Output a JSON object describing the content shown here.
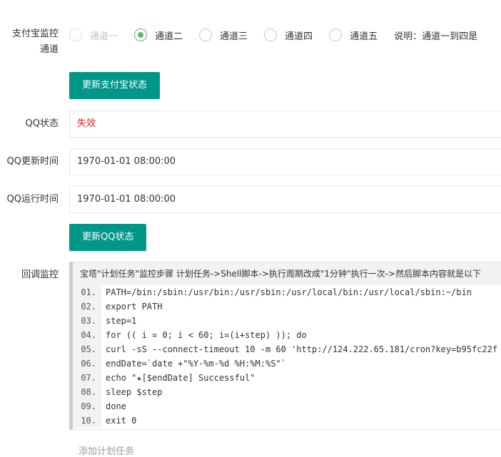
{
  "alipay": {
    "label_line1": "支付宝监控",
    "label_line2": "通道",
    "channels": [
      "通道一",
      "通道二",
      "通道三",
      "通道四",
      "通道五"
    ],
    "selected": "通道二",
    "disabled": "通道一",
    "note": "说明：通道一到四是",
    "update_button": "更新支付宝状态"
  },
  "qq": {
    "status_label": "QQ状态",
    "status_value": "失效",
    "update_time_label": "QQ更新时间",
    "update_time_value": "1970-01-01 08:00:00",
    "run_time_label": "QQ运行时间",
    "run_time_value": "1970-01-01 08:00:00",
    "update_button": "更新QQ状态"
  },
  "callback": {
    "label": "回调监控",
    "header": "宝塔\"计划任务\"监控步骤 计划任务->Shell脚本->执行周期改成\"1分钟\"执行一次->然后脚本内容就是以下",
    "lines": [
      {
        "num": "01.",
        "code": "PATH=/bin:/sbin:/usr/bin:/usr/sbin:/usr/local/bin:/usr/local/sbin:~/bin"
      },
      {
        "num": "02.",
        "code": "export PATH"
      },
      {
        "num": "03.",
        "code": "step=1"
      },
      {
        "num": "04.",
        "code": "for (( i = 0; i < 60; i=(i+step) )); do"
      },
      {
        "num": "05.",
        "code": "curl -sS --connect-timeout 10 -m 60 'http://124.222.65.181/cron?key=b95fc22f"
      },
      {
        "num": "06.",
        "code": "endDate=`date +\"%Y-%m-%d %H:%M:%S\"`"
      },
      {
        "num": "07.",
        "code": "echo \"★[$endDate] Successful\""
      },
      {
        "num": "08.",
        "code": "sleep $step"
      },
      {
        "num": "09.",
        "code": "done"
      },
      {
        "num": "10.",
        "code": "exit 0"
      }
    ]
  },
  "footer_text": "添加计划任务"
}
